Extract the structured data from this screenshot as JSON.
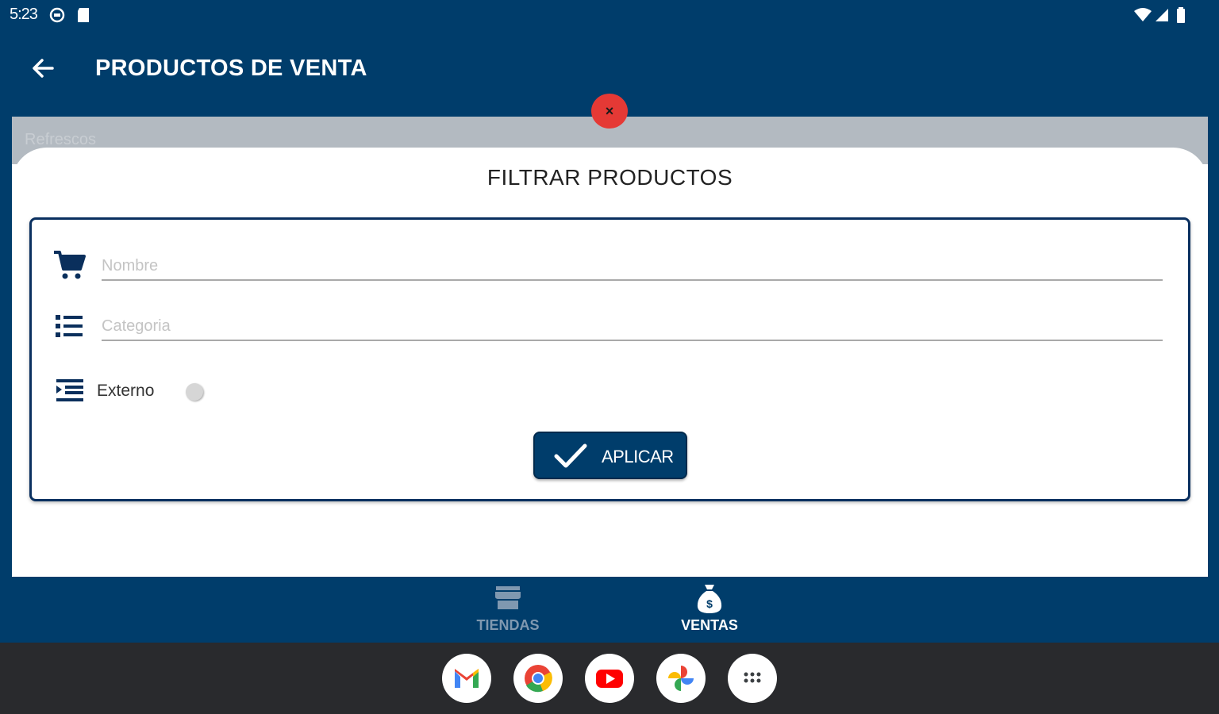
{
  "status_bar": {
    "time": "5:23",
    "icons": [
      "settings-circle-icon",
      "sd-card-icon",
      "wifi-icon",
      "signal-icon",
      "battery-icon"
    ]
  },
  "app_bar": {
    "title": "PRODUCTOS DE VENTA",
    "back_icon": "arrow-back-icon"
  },
  "background_list": {
    "first_item": "Refrescos"
  },
  "close_button": {
    "label": "×",
    "color": "#e53935"
  },
  "filter_sheet": {
    "title": "FILTRAR PRODUCTOS",
    "nombre": {
      "placeholder": "Nombre",
      "value": "",
      "icon": "shopping-cart-icon"
    },
    "categoria": {
      "placeholder": "Categoria",
      "value": "",
      "icon": "list-icon"
    },
    "externo": {
      "label": "Externo",
      "checked": false,
      "icon": "indent-list-icon"
    },
    "apply_button": {
      "label": "APLICAR",
      "icon": "checkmark-icon"
    }
  },
  "bottom_nav": {
    "items": [
      {
        "label": "TIENDAS",
        "icon": "store-icon",
        "active": false
      },
      {
        "label": "VENTAS",
        "icon": "money-bag-icon",
        "active": true
      }
    ]
  },
  "dock": {
    "apps": [
      "gmail-icon",
      "chrome-icon",
      "youtube-icon",
      "photos-icon",
      "app-drawer-icon"
    ]
  },
  "colors": {
    "primary": "#003d6b",
    "accent_close": "#e53935",
    "dock_bg": "#292a2d",
    "nav_inactive": "#7f98b0",
    "nav_active": "#ffffff"
  }
}
